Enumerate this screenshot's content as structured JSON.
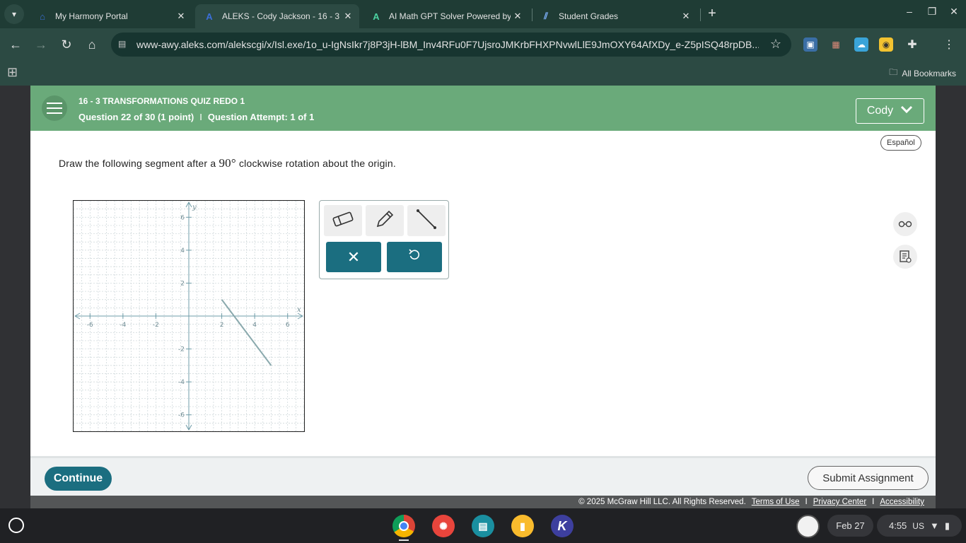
{
  "browser": {
    "tabs": [
      {
        "title": "My Harmony Portal",
        "icon": "harmony-icon",
        "active": false
      },
      {
        "title": "ALEKS - Cody Jackson - 16 - 3 Tr",
        "icon": "aleks-icon",
        "active": true
      },
      {
        "title": "AI Math GPT Solver Powered by",
        "icon": "mathgpt-icon",
        "active": false
      },
      {
        "title": "Student Grades",
        "icon": "grades-icon",
        "active": false
      }
    ],
    "url": "www-awy.aleks.com/alekscgi/x/Isl.exe/1o_u-IgNsIkr7j8P3jH-lBM_Inv4RFu0F7UjsroJMKrbFHXPNvwlLlE9JmOXY64AfXDy_e-Z5pISQ48rpDB...",
    "all_bookmarks": "All Bookmarks"
  },
  "aleks": {
    "quiz_title": "16 - 3 TRANSFORMATIONS QUIZ REDO 1",
    "question_number": "Question 22 of 30 (1 point)",
    "separator": "I",
    "attempt": "Question Attempt: 1 of 1",
    "user": "Cody",
    "espanol": "Español",
    "question_text_pre": "Draw the following segment after a",
    "question_math": "90°",
    "question_text_post": "clockwise rotation about the origin.",
    "continue": "Continue",
    "submit": "Submit Assignment",
    "copyright": "© 2025 McGraw Hill LLC. All Rights Reserved.",
    "links": [
      "Terms of Use",
      "Privacy Center",
      "Accessibility"
    ],
    "link_separator": "I"
  },
  "graph": {
    "x_range": [
      -7,
      7
    ],
    "y_range": [
      -7,
      7
    ],
    "x_ticks": [
      "-6",
      "-4",
      "-2",
      "2",
      "4",
      "6"
    ],
    "y_ticks": [
      "6",
      "4",
      "2",
      "-2",
      "-4",
      "-6"
    ],
    "x_label": "x",
    "y_label": "y",
    "segment": {
      "from": [
        2,
        1
      ],
      "to": [
        5,
        -3
      ]
    },
    "axis_color": "#6f9ca8",
    "segment_color": "#8aa9ad"
  },
  "shelf": {
    "date": "Feb 27",
    "time": "4:55",
    "locale": "US"
  }
}
